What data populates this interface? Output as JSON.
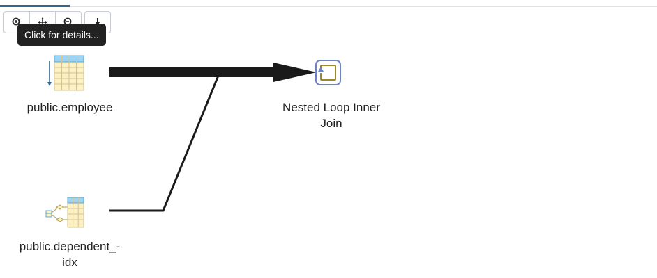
{
  "toolbar": {
    "buttons": [
      {
        "icon": "zoom-in-icon",
        "title": "Zoom in"
      },
      {
        "icon": "zoom-to-original-icon",
        "title": "Zoom to original"
      },
      {
        "icon": "zoom-out-icon",
        "title": "Zoom out"
      },
      {
        "icon": "download-icon",
        "title": "Download"
      }
    ]
  },
  "tooltip": {
    "text": "Click for details..."
  },
  "nodes": {
    "employee": {
      "label": "public.employee",
      "icon": "seq-scan-icon"
    },
    "dependent_idx": {
      "label_line1": "public.dependent_-",
      "label_line2": "idx",
      "icon": "index-scan-icon"
    },
    "join": {
      "label_line1": "Nested Loop Inner",
      "label_line2": "Join",
      "icon": "nested-loop-icon"
    }
  },
  "colors": {
    "edge": "#1a1a1a",
    "table_header": "#9fd3ef",
    "table_body": "#fcf1c4",
    "table_grid": "#d5c490",
    "accent_blue": "#326690",
    "join_border": "#6d84c4",
    "join_inner": "#9a8a2a"
  }
}
